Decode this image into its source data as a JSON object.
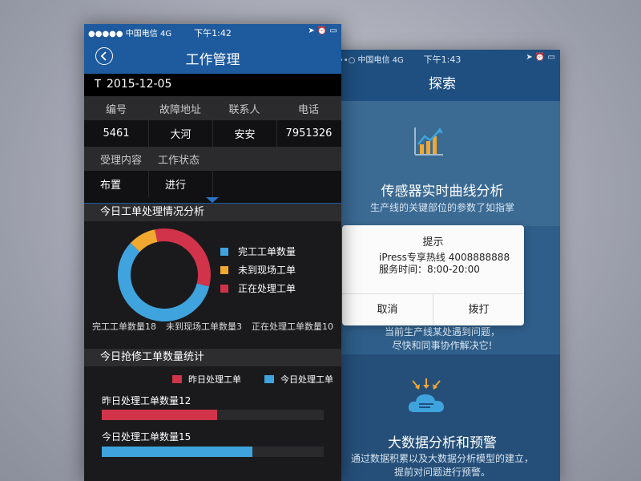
{
  "back_screen": {
    "status": {
      "carrier": "••••○ 中国电信 4G",
      "time": "下午1:43",
      "indicators": "➤ ⏰ ▭"
    },
    "title": "探索",
    "section1": {
      "icon": "chart-growth-icon",
      "title": "传感器实时曲线分析",
      "subtitle": "生产线的关键部位的参数了如指掌"
    },
    "section2": {
      "line1": "当前生产线某处遇到问题，",
      "line2": "尽快和同事协作解决它!"
    },
    "section3": {
      "icon": "cloud-data-icon",
      "title": "大数据分析和预警",
      "line1": "通过数据积累以及大数据分析模型的建立，",
      "line2": "提前对问题进行预警。"
    },
    "dialog": {
      "title": "提示",
      "line1": "iPress专享热线  4008888888",
      "line2": "服务时间：8:00-20:00",
      "cancel": "取消",
      "dial": "拨打"
    }
  },
  "front_screen": {
    "status": {
      "carrier": "●●●●● 中国电信  4G",
      "time": "下午1:42",
      "indicators": "➤ ⏰ ▭"
    },
    "title": "工作管理",
    "date_prefix": "T",
    "date": "2015-12-05",
    "table": {
      "headers": [
        "编号",
        "故障地址",
        "联系人",
        "电话"
      ],
      "values": [
        "5461",
        "大河",
        "安安",
        "7951326"
      ],
      "headers2": [
        "受理内容",
        "工作状态"
      ],
      "values2": [
        "布置",
        "进行"
      ]
    },
    "pie_section": {
      "title": "今日工单处理情况分析",
      "legend": [
        "完工工单数量",
        "未到现场工单",
        "正在处理工单"
      ],
      "counts": [
        "完工工单数量18",
        "未到现场工单数量3",
        "正在处理工单数量10"
      ]
    },
    "bar_section": {
      "title": "今日抢修工单数量统计",
      "legend": [
        "昨日处理工单",
        "今日处理工单"
      ],
      "bars": [
        {
          "label": "昨日处理工单数量12",
          "fraction": 0.52
        },
        {
          "label": "今日处理工单数量15",
          "fraction": 0.68
        }
      ]
    }
  },
  "colors": {
    "completed": "#3fa4dd",
    "not_arrived": "#f0a830",
    "in_progress": "#d0334a",
    "nav_blue": "#1d5a9e"
  },
  "chart_data": [
    {
      "type": "pie",
      "categories": [
        "完工工单数量",
        "未到现场工单",
        "正在处理工单"
      ],
      "values": [
        18,
        3,
        10
      ]
    },
    {
      "type": "bar",
      "categories": [
        "昨日处理工单数量12",
        "今日处理工单数量15"
      ],
      "values": [
        12,
        15
      ]
    }
  ]
}
